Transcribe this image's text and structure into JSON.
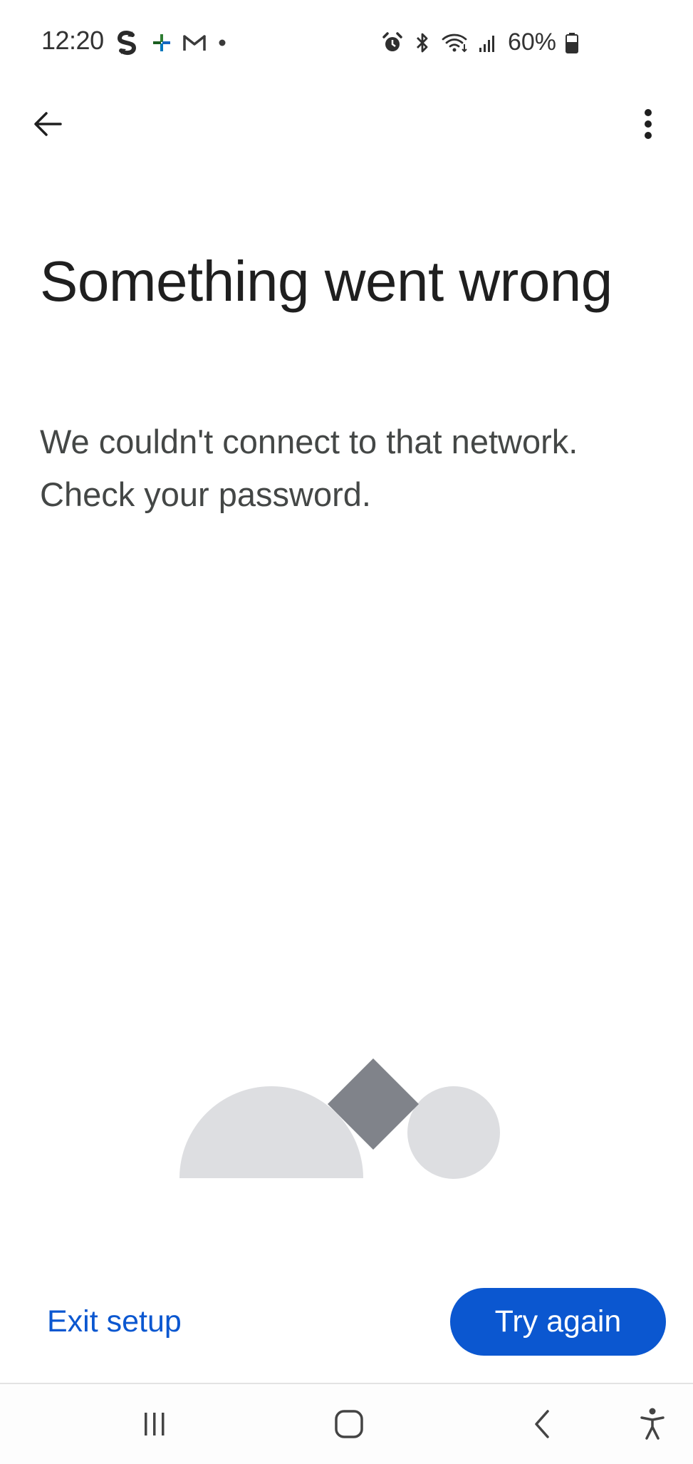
{
  "status_bar": {
    "time": "12:20",
    "battery_percent": "60%",
    "left_icons": [
      "sync-app-icon",
      "pinwheel-app-icon",
      "gmail-icon",
      "notification-dot-icon"
    ],
    "right_icons": [
      "alarm-icon",
      "bluetooth-icon",
      "wifi-icon",
      "signal-icon",
      "battery-icon"
    ]
  },
  "app_bar": {
    "back_icon": "arrow-back-icon",
    "menu_icon": "more-vert-icon"
  },
  "content": {
    "title": "Something went wrong",
    "message": "We couldn't connect to that network. Check your password."
  },
  "actions": {
    "exit_label": "Exit setup",
    "retry_label": "Try again"
  },
  "colors": {
    "primary": "#0b57d0",
    "illustration_light": "#dddee1",
    "illustration_dark": "#80838a"
  },
  "nav_bar": {
    "icons": [
      "recent-apps-icon",
      "home-icon",
      "back-icon",
      "accessibility-icon"
    ]
  }
}
